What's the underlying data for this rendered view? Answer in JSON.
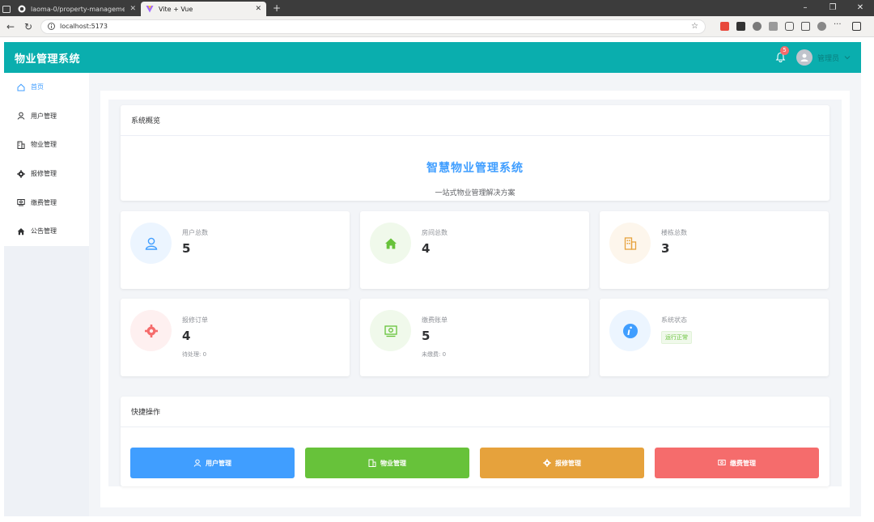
{
  "browser": {
    "tabs": [
      {
        "title": "laoma-0/property-management-"
      },
      {
        "title": "Vite + Vue"
      }
    ],
    "url": "localhost:5173"
  },
  "app": {
    "brand": "物业管理系统",
    "notifications": "5",
    "username": "管理员"
  },
  "sidebar": {
    "items": [
      {
        "label": "首页",
        "icon": "home-icon",
        "active": true
      },
      {
        "label": "用户管理",
        "icon": "user-icon"
      },
      {
        "label": "物业管理",
        "icon": "building-icon"
      },
      {
        "label": "报修管理",
        "icon": "gear-icon"
      },
      {
        "label": "缴费管理",
        "icon": "money-icon"
      },
      {
        "label": "公告管理",
        "icon": "house-filled-icon"
      }
    ]
  },
  "overview": {
    "header": "系统概览",
    "title": "智慧物业管理系统",
    "subtitle": "一站式物业管理解决方案"
  },
  "stats": {
    "users": {
      "label": "用户总数",
      "value": "5"
    },
    "rooms": {
      "label": "房间总数",
      "value": "4"
    },
    "buildings": {
      "label": "楼栋总数",
      "value": "3"
    },
    "repairs": {
      "label": "报修订单",
      "value": "4",
      "sub": "待处理: 0"
    },
    "bills": {
      "label": "缴费账单",
      "value": "5",
      "sub": "未缴费: 0"
    },
    "status": {
      "label": "系统状态",
      "tag": "运行正常"
    }
  },
  "quick": {
    "header": "快捷操作",
    "buttons": [
      {
        "label": "用户管理",
        "color": "#409eff"
      },
      {
        "label": "物业管理",
        "color": "#67c23a"
      },
      {
        "label": "报修管理",
        "color": "#e6a23c"
      },
      {
        "label": "缴费管理",
        "color": "#f56c6c"
      }
    ]
  },
  "colors": {
    "accent": "#0aaeae",
    "primary": "#409eff",
    "success": "#67c23a",
    "warning": "#e6a23c",
    "danger": "#f56c6c"
  }
}
